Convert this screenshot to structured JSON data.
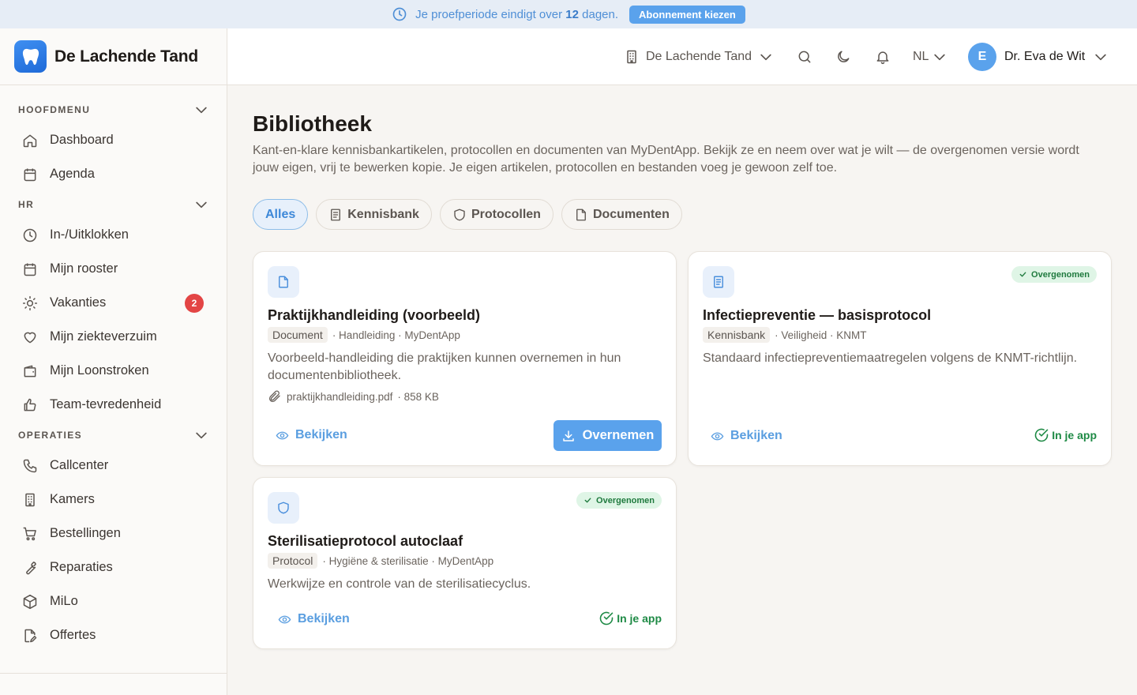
{
  "banner": {
    "text_before": "Je proefperiode eindigt over",
    "days": "12",
    "text_after": "dagen.",
    "cta": "Abonnement kiezen"
  },
  "sidebar": {
    "brand": "De Lachende Tand",
    "sections": [
      {
        "label": "HOOFDMENU",
        "items": [
          {
            "label": "Dashboard",
            "icon": "home-icon"
          },
          {
            "label": "Agenda",
            "icon": "calendar-icon"
          }
        ]
      },
      {
        "label": "HR",
        "items": [
          {
            "label": "In-/Uitklokken",
            "icon": "clock-icon"
          },
          {
            "label": "Mijn rooster",
            "icon": "calendar-icon"
          },
          {
            "label": "Vakanties",
            "icon": "sun-icon",
            "badge": "2"
          },
          {
            "label": "Mijn ziekteverzuim",
            "icon": "heart-icon"
          },
          {
            "label": "Mijn Loonstroken",
            "icon": "wallet-icon"
          },
          {
            "label": "Team-tevredenheid",
            "icon": "thumbs-up-icon"
          }
        ]
      },
      {
        "label": "OPERATIES",
        "items": [
          {
            "label": "Callcenter",
            "icon": "phone-icon"
          },
          {
            "label": "Kamers",
            "icon": "building-icon"
          },
          {
            "label": "Bestellingen",
            "icon": "cart-icon"
          },
          {
            "label": "Reparaties",
            "icon": "wrench-icon"
          },
          {
            "label": "MiLo",
            "icon": "box-icon"
          },
          {
            "label": "Offertes",
            "icon": "file-edit-icon"
          }
        ]
      }
    ]
  },
  "header": {
    "practice": "De Lachende Tand",
    "language": "NL",
    "user_initial": "E",
    "user_name": "Dr. Eva de Wit"
  },
  "page": {
    "title": "Bibliotheek",
    "description": "Kant-en-klare kennisbankartikelen, protocollen en documenten van MyDentApp. Bekijk ze en neem over wat je wilt — de overgenomen versie wordt jouw eigen, vrij te bewerken kopie. Je eigen artikelen, protocollen en bestanden voeg je gewoon zelf toe.",
    "filters": [
      {
        "label": "Alles",
        "active": true
      },
      {
        "label": "Kennisbank",
        "icon": "book-icon"
      },
      {
        "label": "Protocollen",
        "icon": "shield-icon"
      },
      {
        "label": "Documenten",
        "icon": "file-icon"
      }
    ]
  },
  "cards": [
    {
      "title": "Praktijkhandleiding (voorbeeld)",
      "type": "Document",
      "meta": "· Handleiding · MyDentApp",
      "description": "Voorbeeld-handleiding die praktijken kunnen overnemen in hun documentenbibliotheek.",
      "file_name": "praktijkhandleiding.pdf",
      "file_size": "· 858 KB",
      "view_label": "Bekijken",
      "action_label": "Overnemen"
    },
    {
      "title": "Infectiepreventie — basisprotocol",
      "type": "Kennisbank",
      "meta": "· Veiligheid · KNMT",
      "description": "Standaard infectiepreventiemaatregelen volgens de KNMT-richtlijn.",
      "badge": "Overgenomen",
      "view_label": "Bekijken",
      "status_label": "In je app"
    },
    {
      "title": "Sterilisatieprotocol autoclaaf",
      "type": "Protocol",
      "meta": "· Hygiëne & sterilisatie · MyDentApp",
      "description": "Werkwijze en controle van de sterilisatiecyclus.",
      "badge": "Overgenomen",
      "view_label": "Bekijken",
      "status_label": "In je app"
    }
  ],
  "colors": {
    "accent": "#5aa2ec",
    "success": "#1e8a45",
    "danger": "#e34545",
    "background": "#f7f5f2"
  }
}
